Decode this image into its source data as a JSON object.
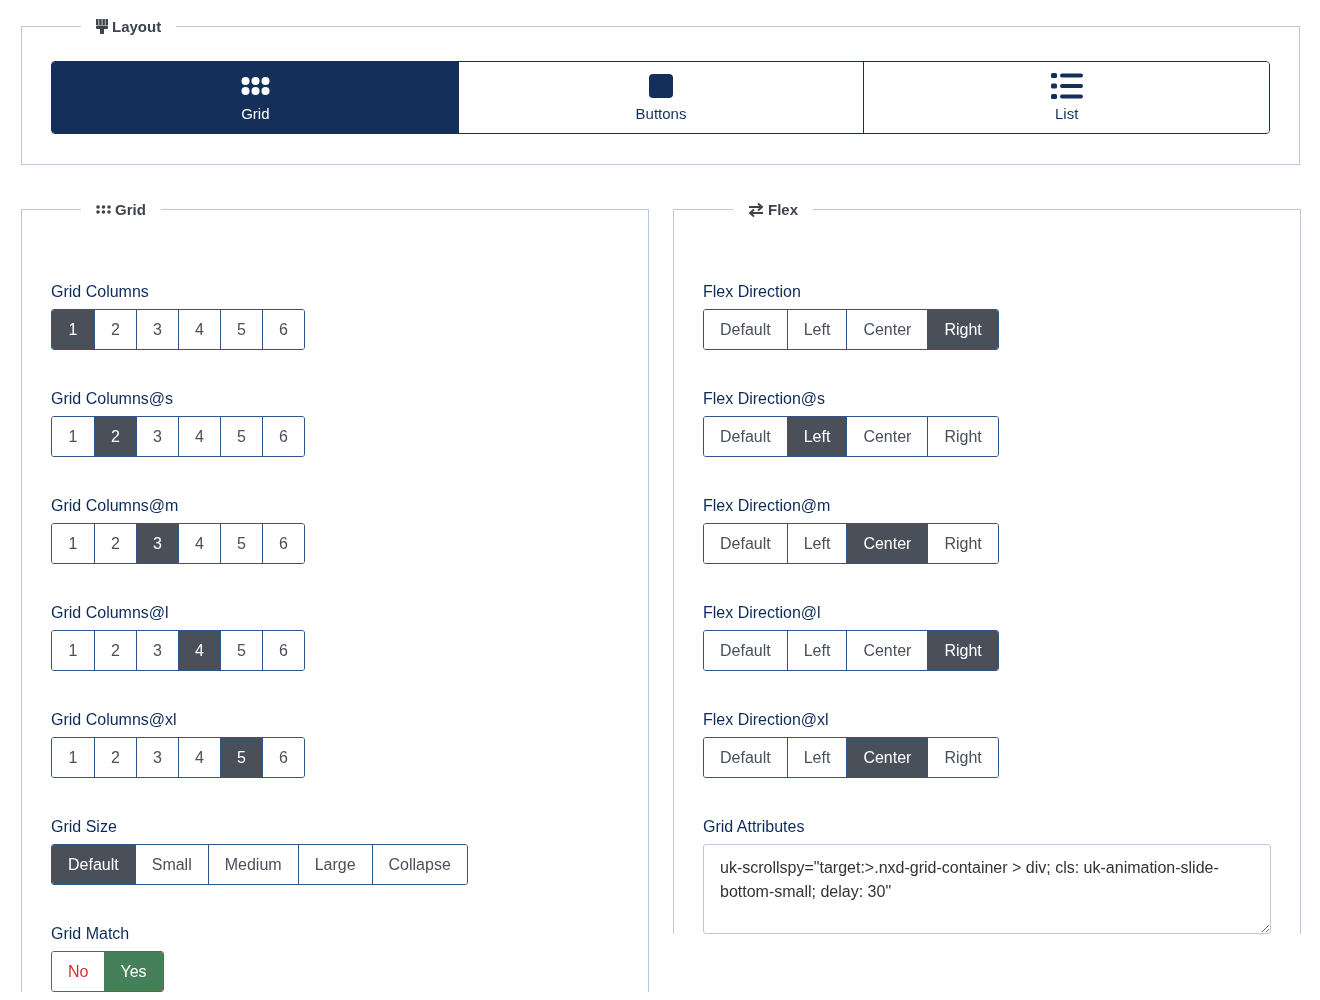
{
  "layout": {
    "legend": "Layout",
    "options": [
      {
        "label": "Grid",
        "kind": "grid",
        "selected": true
      },
      {
        "label": "Buttons",
        "kind": "square",
        "selected": false
      },
      {
        "label": "List",
        "kind": "list",
        "selected": false
      }
    ]
  },
  "grid_panel": {
    "legend": "Grid",
    "groups": [
      {
        "kind": "segmented",
        "label": "Grid Columns",
        "options": [
          {
            "label": "1",
            "selected": true
          },
          {
            "label": "2",
            "selected": false
          },
          {
            "label": "3",
            "selected": false
          },
          {
            "label": "4",
            "selected": false
          },
          {
            "label": "5",
            "selected": false
          },
          {
            "label": "6",
            "selected": false
          }
        ]
      },
      {
        "kind": "segmented",
        "label": "Grid Columns@s",
        "options": [
          {
            "label": "1",
            "selected": false
          },
          {
            "label": "2",
            "selected": true
          },
          {
            "label": "3",
            "selected": false
          },
          {
            "label": "4",
            "selected": false
          },
          {
            "label": "5",
            "selected": false
          },
          {
            "label": "6",
            "selected": false
          }
        ]
      },
      {
        "kind": "segmented",
        "label": "Grid Columns@m",
        "options": [
          {
            "label": "1",
            "selected": false
          },
          {
            "label": "2",
            "selected": false
          },
          {
            "label": "3",
            "selected": true
          },
          {
            "label": "4",
            "selected": false
          },
          {
            "label": "5",
            "selected": false
          },
          {
            "label": "6",
            "selected": false
          }
        ]
      },
      {
        "kind": "segmented",
        "label": "Grid Columns@l",
        "options": [
          {
            "label": "1",
            "selected": false
          },
          {
            "label": "2",
            "selected": false
          },
          {
            "label": "3",
            "selected": false
          },
          {
            "label": "4",
            "selected": true
          },
          {
            "label": "5",
            "selected": false
          },
          {
            "label": "6",
            "selected": false
          }
        ]
      },
      {
        "kind": "segmented",
        "label": "Grid Columns@xl",
        "options": [
          {
            "label": "1",
            "selected": false
          },
          {
            "label": "2",
            "selected": false
          },
          {
            "label": "3",
            "selected": false
          },
          {
            "label": "4",
            "selected": false
          },
          {
            "label": "5",
            "selected": true
          },
          {
            "label": "6",
            "selected": false
          }
        ]
      },
      {
        "kind": "segmented",
        "label": "Grid Size",
        "options": [
          {
            "label": "Default",
            "selected": true
          },
          {
            "label": "Small",
            "selected": false
          },
          {
            "label": "Medium",
            "selected": false
          },
          {
            "label": "Large",
            "selected": false
          },
          {
            "label": "Collapse",
            "selected": false
          }
        ]
      },
      {
        "kind": "yesno",
        "label": "Grid Match",
        "options": [
          {
            "label": "No",
            "selected": false,
            "color": "#d32f2f"
          },
          {
            "label": "Yes",
            "selected": true,
            "color": "#46805a"
          }
        ]
      }
    ]
  },
  "flex_panel": {
    "legend": "Flex",
    "groups": [
      {
        "kind": "segmented",
        "label": "Flex Direction",
        "options": [
          {
            "label": "Default",
            "selected": false
          },
          {
            "label": "Left",
            "selected": false
          },
          {
            "label": "Center",
            "selected": false
          },
          {
            "label": "Right",
            "selected": true
          }
        ]
      },
      {
        "kind": "segmented",
        "label": "Flex Direction@s",
        "options": [
          {
            "label": "Default",
            "selected": false
          },
          {
            "label": "Left",
            "selected": true
          },
          {
            "label": "Center",
            "selected": false
          },
          {
            "label": "Right",
            "selected": false
          }
        ]
      },
      {
        "kind": "segmented",
        "label": "Flex Direction@m",
        "options": [
          {
            "label": "Default",
            "selected": false
          },
          {
            "label": "Left",
            "selected": false
          },
          {
            "label": "Center",
            "selected": true
          },
          {
            "label": "Right",
            "selected": false
          }
        ]
      },
      {
        "kind": "segmented",
        "label": "Flex Direction@l",
        "options": [
          {
            "label": "Default",
            "selected": false
          },
          {
            "label": "Left",
            "selected": false
          },
          {
            "label": "Center",
            "selected": false
          },
          {
            "label": "Right",
            "selected": true
          }
        ]
      },
      {
        "kind": "segmented",
        "label": "Flex Direction@xl",
        "options": [
          {
            "label": "Default",
            "selected": false
          },
          {
            "label": "Left",
            "selected": false
          },
          {
            "label": "Center",
            "selected": true
          },
          {
            "label": "Right",
            "selected": false
          }
        ]
      },
      {
        "kind": "textarea",
        "label": "Grid Attributes",
        "value": "uk-scrollspy=\"target:>.nxd-grid-container > div; cls: uk-animation-slide-bottom-small; delay: 30\""
      }
    ]
  }
}
